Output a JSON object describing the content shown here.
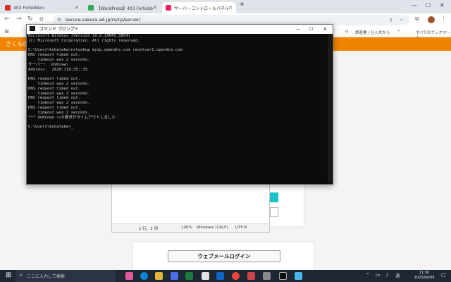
{
  "browser": {
    "tabs": [
      {
        "title": "403 Forbidden",
        "favicon_color": "#d93025"
      },
      {
        "title": "【WordPress】403 Forbidden エラ",
        "favicon_color": "#34a853"
      },
      {
        "title": "サーバーコントロールパネル",
        "favicon_color": "#e91e63"
      }
    ],
    "new_tab": "+",
    "address": "secure.sakura.ad.jp/rs/cp/server/",
    "bookmarks": [
      "G",
      "調査書 / 仕入先から",
      "»",
      "すべてのブックマーク"
    ]
  },
  "page": {
    "header_text": "さくらの",
    "webmail_button": "ウェブメールログイン"
  },
  "cmd": {
    "title": "コマンド プロンプト",
    "lines": [
      "Microsoft Windows [Version 10.0.19045.5854]",
      "(c) Microsoft Corporation. All rights reserved.",
      "",
      "C:\\Users\\kobatake>nslookup myip.opendns.com resolver1.opendns.com",
      "DNS request timed out.",
      "    timeout was 2 seconds.",
      "サーバー:  UnKnown",
      "Address:  2620:119:35::35",
      "",
      "DNS request timed out.",
      "    timeout was 2 seconds.",
      "DNS request timed out.",
      "    timeout was 2 seconds.",
      "DNS request timed out.",
      "    timeout was 2 seconds.",
      "DNS request timed out.",
      "    timeout was 2 seconds.",
      "*** UnKnown への要求がタイムアウトしました",
      "",
      "C:\\Users\\kobatake>_"
    ]
  },
  "notepad": {
    "status": {
      "position": "1 行、1 列",
      "zoom": "100%",
      "line_ending": "Windows (CRLF)",
      "encoding": "UTF-8"
    }
  },
  "taskbar": {
    "search_placeholder": "ここに入力して検索",
    "time": "11:30",
    "date": "2025/06/09"
  }
}
